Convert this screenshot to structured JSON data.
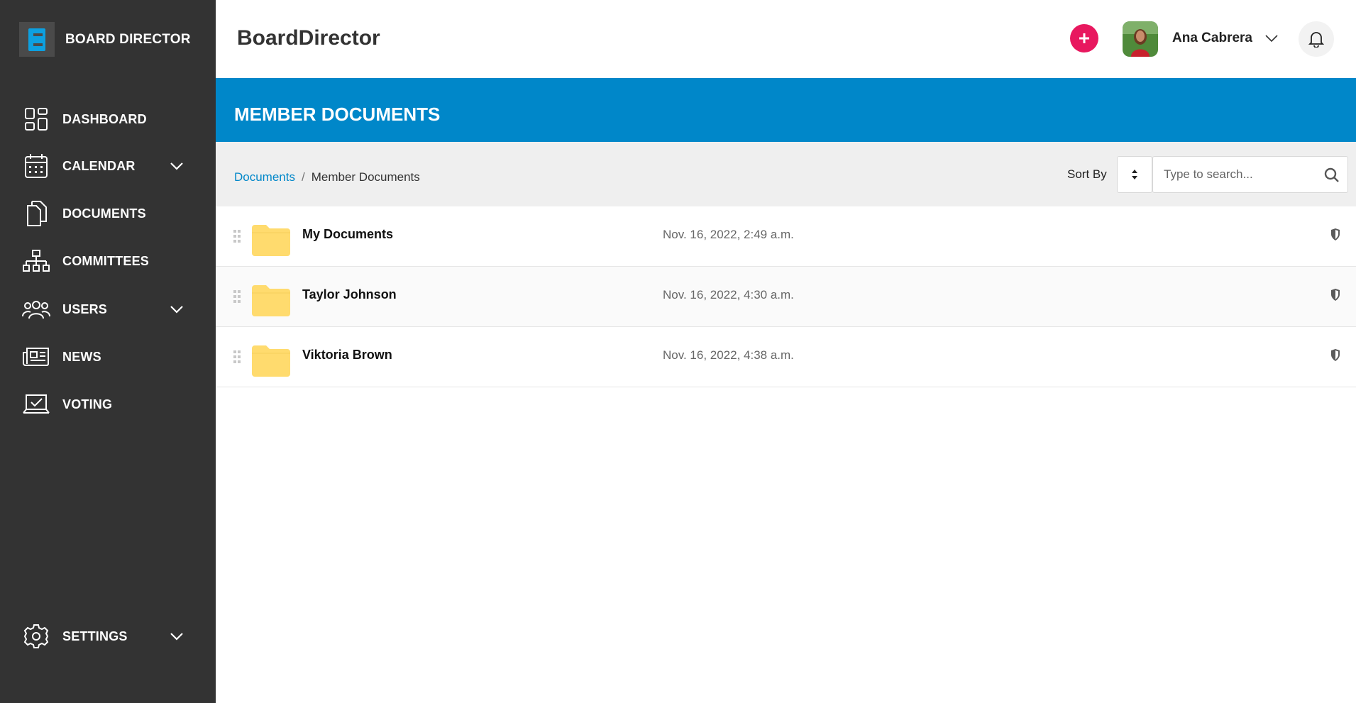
{
  "brand": {
    "name": "BOARD DIRECTOR",
    "icon": "board-director-logo",
    "logo_color": "#0da0e0"
  },
  "sidebar": {
    "background": "#333333",
    "items": [
      {
        "label": "DASHBOARD",
        "icon": "dashboard-icon",
        "expandable": false
      },
      {
        "label": "CALENDAR",
        "icon": "calendar-icon",
        "expandable": true
      },
      {
        "label": "DOCUMENTS",
        "icon": "documents-icon",
        "expandable": false
      },
      {
        "label": "COMMITTEES",
        "icon": "committees-icon",
        "expandable": false
      },
      {
        "label": "USERS",
        "icon": "users-icon",
        "expandable": true
      },
      {
        "label": "NEWS",
        "icon": "news-icon",
        "expandable": false
      },
      {
        "label": "VOTING",
        "icon": "voting-icon",
        "expandable": false
      }
    ],
    "settings": {
      "label": "SETTINGS",
      "icon": "gear-icon",
      "expandable": true
    }
  },
  "header": {
    "title": "BoardDirector",
    "add_button_color": "#e8185f",
    "user": {
      "name": "Ana Cabrera",
      "avatar": "user-avatar"
    }
  },
  "banner": {
    "title": "MEMBER DOCUMENTS",
    "color": "#0087c9"
  },
  "breadcrumb": {
    "parent": "Documents",
    "separator": "/",
    "current": "Member Documents"
  },
  "sort": {
    "label": "Sort By"
  },
  "search": {
    "placeholder": "Type to search..."
  },
  "folders": [
    {
      "name": "My Documents",
      "date": "Nov. 16, 2022, 2:49 a.m."
    },
    {
      "name": "Taylor Johnson",
      "date": "Nov. 16, 2022, 4:30 a.m."
    },
    {
      "name": "Viktoria Brown",
      "date": "Nov. 16, 2022, 4:38 a.m."
    }
  ],
  "colors": {
    "folder": "#ffdb6e",
    "accent": "#0087c9",
    "sidebar": "#333333"
  }
}
